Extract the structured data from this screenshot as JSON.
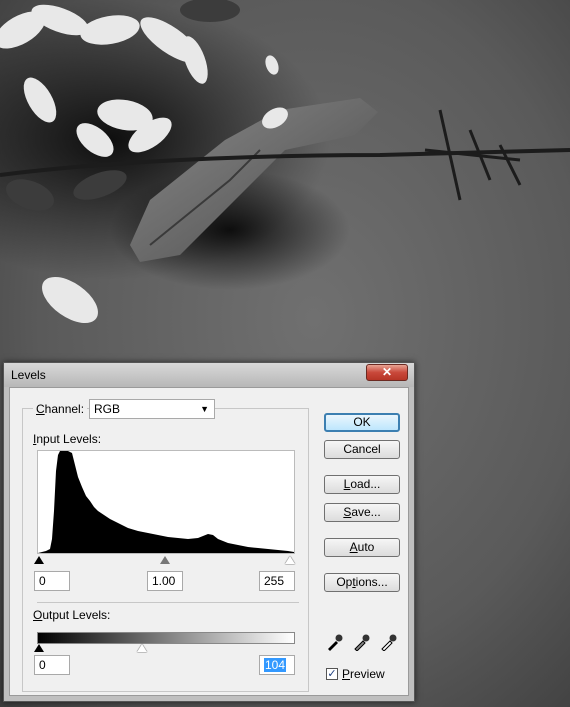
{
  "dialog": {
    "title": "Levels",
    "close_label": "✕"
  },
  "channel": {
    "label": "Channel:",
    "value": "RGB"
  },
  "input_levels": {
    "label": "Input Levels:",
    "black": "0",
    "gamma": "1.00",
    "white": "255"
  },
  "output_levels": {
    "label": "Output Levels:",
    "black": "0",
    "white": "104"
  },
  "buttons": {
    "ok": "OK",
    "cancel": "Cancel",
    "load": "Load...",
    "save": "Save...",
    "auto": "Auto",
    "options": "Options..."
  },
  "preview": {
    "label": "Preview",
    "checked": true
  }
}
